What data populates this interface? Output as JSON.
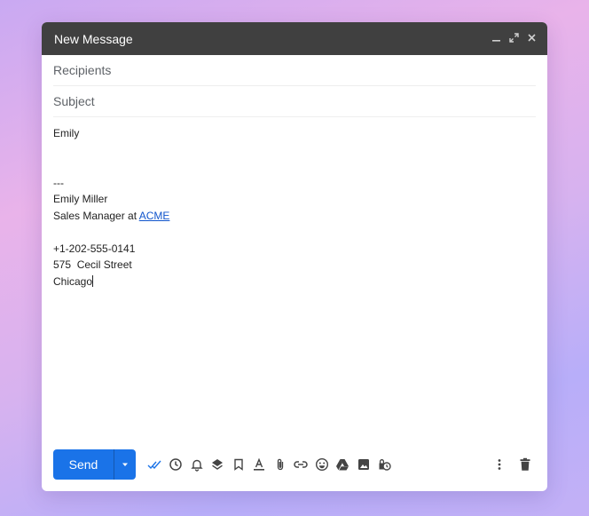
{
  "window": {
    "title": "New Message",
    "controls": [
      "minimize-icon",
      "expand-icon",
      "close-icon"
    ]
  },
  "recipients": {
    "placeholder": "Recipients",
    "value": ""
  },
  "subject": {
    "placeholder": "Subject",
    "value": ""
  },
  "body": {
    "greeting": "Emily",
    "separator": "---",
    "name": "Emily Miller",
    "title_prefix": "Sales Manager at ",
    "company_link": "ACME",
    "phone": "+1-202-555-0141",
    "street": "575  Cecil Street",
    "city": "Chicago"
  },
  "toolbar": {
    "send_label": "Send",
    "icons": [
      "double-check-icon",
      "clock-icon",
      "bell-icon",
      "layers-icon",
      "bookmark-icon",
      "text-format-icon",
      "attach-icon",
      "link-icon",
      "emoji-icon",
      "drive-icon",
      "photo-icon",
      "confidential-icon",
      "more-options-icon",
      "trash-icon"
    ]
  },
  "colors": {
    "titlebar": "#404040",
    "send": "#1a73e8",
    "accent_check": "#1a73e8",
    "link": "#1155cc"
  }
}
